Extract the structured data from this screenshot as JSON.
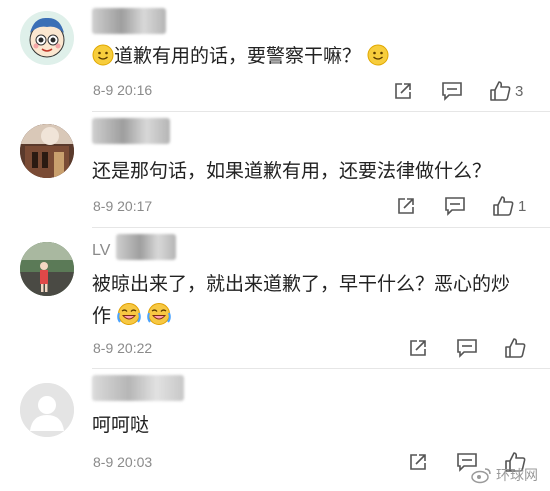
{
  "comments": [
    {
      "username": "",
      "text": "道歉有用的话，要警察干嘛？",
      "time": "8-9 20:16",
      "like_count": "3"
    },
    {
      "username": "",
      "text": "还是那句话，如果道歉有用，还要法律做什么？",
      "time": "8-9 20:17",
      "like_count": "1"
    },
    {
      "username": "LV",
      "text_line1": "被晾出来了，就出来道歉了，早干什么？恶心的炒",
      "text_line2": "作",
      "time": "8-9 20:22",
      "like_count": ""
    },
    {
      "username": "",
      "text": "呵呵哒",
      "time": "8-9 20:03",
      "like_count": ""
    }
  ],
  "watermark": "环球网",
  "icons": [
    "share-icon",
    "reply-icon",
    "like-icon",
    "smiley-emoji",
    "crying-laugh-emoji",
    "weibo-logo"
  ]
}
